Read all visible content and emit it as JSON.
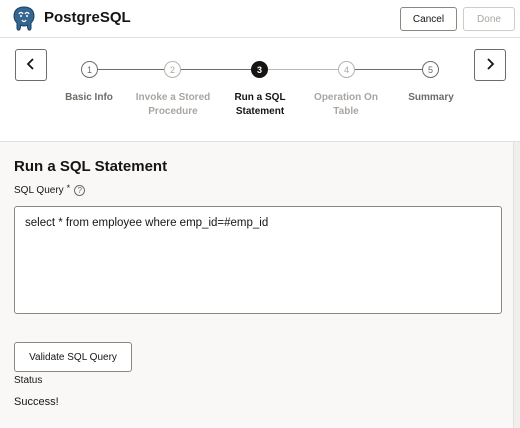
{
  "header": {
    "title": "PostgreSQL",
    "logo_icon": "postgresql-elephant-icon",
    "cancel_label": "Cancel",
    "done_label": "Done"
  },
  "train": {
    "prev_icon": "chevron-left-icon",
    "next_icon": "chevron-right-icon",
    "steps": [
      {
        "number": "1",
        "label_line1": "Basic Info",
        "label_line2": "",
        "state": "visited"
      },
      {
        "number": "2",
        "label_line1": "Invoke a Stored",
        "label_line2": "Procedure",
        "state": "disabled"
      },
      {
        "number": "3",
        "label_line1": "Run a SQL",
        "label_line2": "Statement",
        "state": "current"
      },
      {
        "number": "4",
        "label_line1": "Operation On",
        "label_line2": "Table",
        "state": "disabled"
      },
      {
        "number": "5",
        "label_line1": "Summary",
        "label_line2": "",
        "state": "visited"
      }
    ]
  },
  "content": {
    "section_title": "Run a SQL Statement",
    "sql_label": "SQL Query",
    "required_marker": "*",
    "help_glyph": "?",
    "sql_value": "select * from employee where emp_id=#emp_id",
    "validate_label": "Validate SQL Query",
    "status_label": "Status",
    "status_value": "Success!"
  }
}
